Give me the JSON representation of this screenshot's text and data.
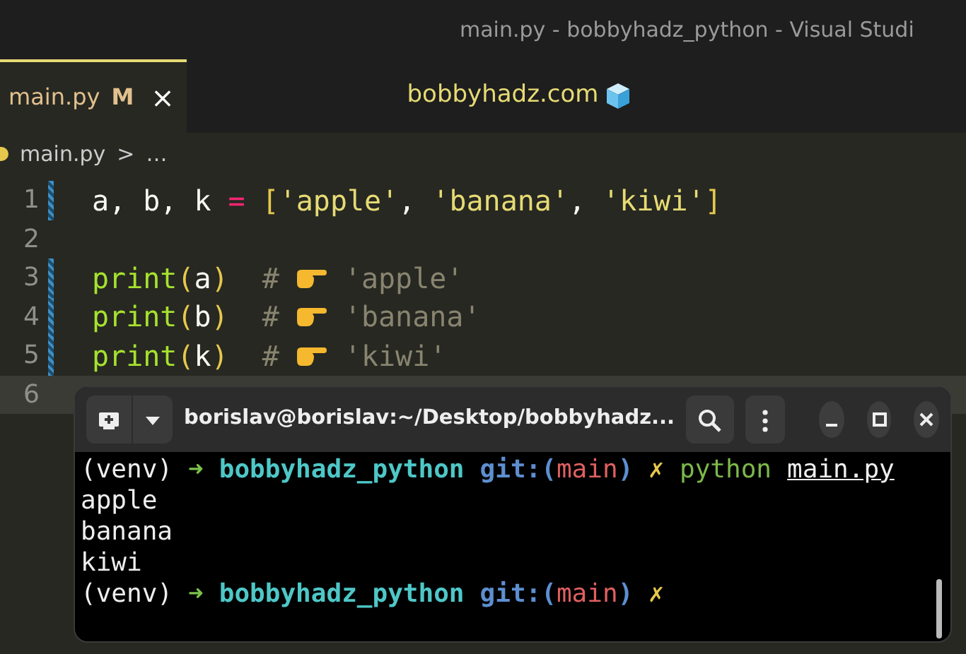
{
  "window": {
    "title": "main.py - bobbyhadz_python - Visual Studi"
  },
  "tabs": [
    {
      "label": "main.py",
      "badge": "M",
      "close": "×",
      "selected": true
    }
  ],
  "banner": {
    "text": "bobbyhadz.com"
  },
  "breadcrumb": {
    "file": "main.py",
    "separator": ">",
    "more": "…"
  },
  "editor": {
    "lines": [
      {
        "number": "1",
        "changed": true,
        "current": false,
        "groups": [
          [
            {
              "kind": "plain",
              "text": "a,"
            }
          ],
          [
            {
              "kind": "plain",
              "text": "b,"
            }
          ],
          [
            {
              "kind": "plain",
              "text": "k"
            }
          ],
          [
            {
              "kind": "op",
              "text": "="
            }
          ],
          [
            {
              "kind": "bracket",
              "text": "["
            },
            {
              "kind": "string",
              "text": "'apple'"
            },
            {
              "kind": "plain",
              "text": ","
            }
          ],
          [
            {
              "kind": "string",
              "text": "'banana'"
            },
            {
              "kind": "plain",
              "text": ","
            }
          ],
          [
            {
              "kind": "string",
              "text": "'kiwi'"
            },
            {
              "kind": "bracket",
              "text": "]"
            }
          ]
        ]
      },
      {
        "number": "2",
        "changed": false,
        "current": false
      },
      {
        "number": "3",
        "changed": true,
        "current": false,
        "groups": [
          [
            {
              "kind": "fn",
              "text": "print"
            },
            {
              "kind": "bracket",
              "text": "("
            },
            {
              "kind": "plain",
              "text": "a"
            },
            {
              "kind": "bracket",
              "text": ")"
            }
          ],
          [
            {
              "kind": "comment",
              "text": "#"
            }
          ],
          [
            {
              "kind": "hand"
            }
          ],
          [
            {
              "kind": "comment",
              "text": "'apple'"
            }
          ]
        ]
      },
      {
        "number": "4",
        "changed": true,
        "current": false,
        "groups": [
          [
            {
              "kind": "fn",
              "text": "print"
            },
            {
              "kind": "bracket",
              "text": "("
            },
            {
              "kind": "plain",
              "text": "b"
            },
            {
              "kind": "bracket",
              "text": ")"
            }
          ],
          [
            {
              "kind": "comment",
              "text": "#"
            }
          ],
          [
            {
              "kind": "hand"
            }
          ],
          [
            {
              "kind": "comment",
              "text": "'banana'"
            }
          ]
        ]
      },
      {
        "number": "5",
        "changed": true,
        "current": false,
        "groups": [
          [
            {
              "kind": "fn",
              "text": "print"
            },
            {
              "kind": "bracket",
              "text": "("
            },
            {
              "kind": "plain",
              "text": "k"
            },
            {
              "kind": "bracket",
              "text": ")"
            }
          ],
          [
            {
              "kind": "comment",
              "text": "#"
            }
          ],
          [
            {
              "kind": "hand"
            }
          ],
          [
            {
              "kind": "comment",
              "text": "'kiwi'"
            }
          ]
        ]
      },
      {
        "number": "6",
        "changed": false,
        "current": true
      }
    ]
  },
  "terminal": {
    "title": "borislav@borislav:~/Desktop/bobbyhadz...",
    "lines": [
      [
        [
          {
            "kind": "plain",
            "text": "(venv)"
          }
        ],
        [
          {
            "kind": "arrow",
            "text": "➜"
          }
        ],
        [
          {
            "kind": "dir",
            "text": "bobbyhadz_python"
          }
        ],
        [
          {
            "kind": "git",
            "text": "git:("
          },
          {
            "kind": "branch",
            "text": "main"
          },
          {
            "kind": "git",
            "text": ")"
          }
        ],
        [
          {
            "kind": "dirty",
            "text": "✗"
          }
        ],
        [
          {
            "kind": "cmd",
            "text": "python"
          }
        ],
        [
          {
            "kind": "arg",
            "text": "main.py"
          }
        ]
      ],
      [
        [
          {
            "kind": "plain",
            "text": "apple"
          }
        ]
      ],
      [
        [
          {
            "kind": "plain",
            "text": "banana"
          }
        ]
      ],
      [
        [
          {
            "kind": "plain",
            "text": "kiwi"
          }
        ]
      ],
      [
        [
          {
            "kind": "plain",
            "text": "(venv)"
          }
        ],
        [
          {
            "kind": "arrow",
            "text": "➜"
          }
        ],
        [
          {
            "kind": "dir",
            "text": "bobbyhadz_python"
          }
        ],
        [
          {
            "kind": "git",
            "text": "git:("
          },
          {
            "kind": "branch",
            "text": "main"
          },
          {
            "kind": "git",
            "text": ")"
          }
        ],
        [
          {
            "kind": "dirty",
            "text": "✗"
          }
        ]
      ]
    ]
  }
}
